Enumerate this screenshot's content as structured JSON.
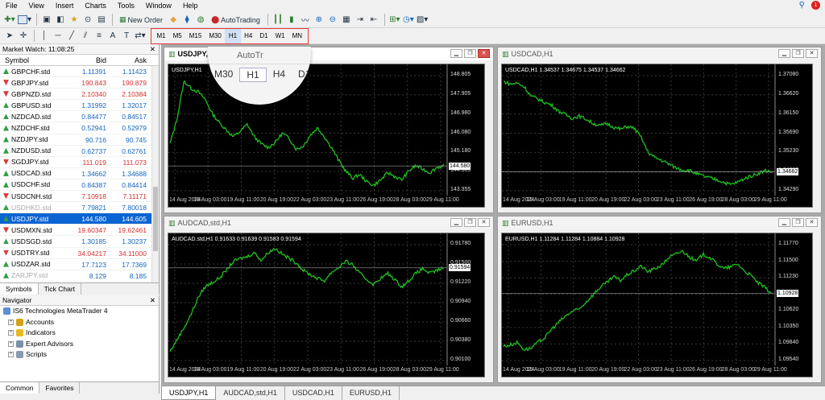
{
  "menu": [
    "File",
    "View",
    "Insert",
    "Charts",
    "Tools",
    "Window",
    "Help"
  ],
  "toolbar": {
    "new_order": "New Order",
    "autotrading": "AutoTrading"
  },
  "timeframes": [
    "M1",
    "M5",
    "M15",
    "M30",
    "H1",
    "H4",
    "D1",
    "W1",
    "MN"
  ],
  "selected_timeframe": "H1",
  "magnifier": {
    "items": [
      "M30",
      "H1",
      "H4",
      "D1"
    ],
    "partial_text": "AutoTr"
  },
  "market_watch": {
    "title": "Market Watch: 11:08:25",
    "headers": {
      "symbol": "Symbol",
      "bid": "Bid",
      "ask": "Ask"
    },
    "rows": [
      {
        "symbol": "GBPCHF.std",
        "bid": "1.11391",
        "ask": "1.11423",
        "dir": "up"
      },
      {
        "symbol": "GBPJPY.std",
        "bid": "190.843",
        "ask": "190.879",
        "dir": "dn"
      },
      {
        "symbol": "GBPNZD.std",
        "bid": "2.10340",
        "ask": "2.10384",
        "dir": "dn"
      },
      {
        "symbol": "GBPUSD.std",
        "bid": "1.31992",
        "ask": "1.32017",
        "dir": "up"
      },
      {
        "symbol": "NZDCAD.std",
        "bid": "0.84477",
        "ask": "0.84517",
        "dir": "up"
      },
      {
        "symbol": "NZDCHF.std",
        "bid": "0.52941",
        "ask": "0.52979",
        "dir": "up"
      },
      {
        "symbol": "NZDJPY.std",
        "bid": "90.716",
        "ask": "90.745",
        "dir": "up"
      },
      {
        "symbol": "NZDUSD.std",
        "bid": "0.62737",
        "ask": "0.62761",
        "dir": "up"
      },
      {
        "symbol": "SGDJPY.std",
        "bid": "111.019",
        "ask": "111.073",
        "dir": "dn"
      },
      {
        "symbol": "USDCAD.std",
        "bid": "1.34662",
        "ask": "1.34688",
        "dir": "up"
      },
      {
        "symbol": "USDCHF.std",
        "bid": "0.84387",
        "ask": "0.84414",
        "dir": "up"
      },
      {
        "symbol": "USDCNH.std",
        "bid": "7.10918",
        "ask": "7.11171",
        "dir": "dn"
      },
      {
        "symbol": "USDHKD.std",
        "bid": "7.79821",
        "ask": "7.80018",
        "dir": "up",
        "faded": true
      },
      {
        "symbol": "USDJPY.std",
        "bid": "144.580",
        "ask": "144.605",
        "dir": "up",
        "selected": true
      },
      {
        "symbol": "USDMXN.std",
        "bid": "19.60347",
        "ask": "19.62461",
        "dir": "dn"
      },
      {
        "symbol": "USDSGD.std",
        "bid": "1.30185",
        "ask": "1.30237",
        "dir": "up"
      },
      {
        "symbol": "USDTRY.std",
        "bid": "34.04217",
        "ask": "34.11000",
        "dir": "dn"
      },
      {
        "symbol": "USDZAR.std",
        "bid": "17.7123",
        "ask": "17.7369",
        "dir": "up"
      },
      {
        "symbol": "ZARJPY.std",
        "bid": "8.129",
        "ask": "8.185",
        "dir": "up",
        "faded": true
      }
    ],
    "tabs": [
      "Symbols",
      "Tick Chart"
    ]
  },
  "navigator": {
    "title": "Navigator",
    "root": "IS6 Technologies MetaTrader 4",
    "items": [
      "Accounts",
      "Indicators",
      "Expert Advisors",
      "Scripts"
    ],
    "tabs": [
      "Common",
      "Favorites"
    ]
  },
  "charts": [
    {
      "title": "USDJPY,H1",
      "info": "USDJPY,H1",
      "price_label": "144.580",
      "yticks": [
        "148.805",
        "147.905",
        "146.980",
        "146.080",
        "145.180",
        "144.305",
        "143.355"
      ],
      "xticks": [
        "14 Aug 2024",
        "16 Aug 03:00",
        "19 Aug 11:00",
        "20 Aug 19:00",
        "22 Aug 03:00",
        "23 Aug 11:00",
        "26 Aug 19:00",
        "28 Aug 03:00",
        "29 Aug 11:00"
      ],
      "values": [
        145.8,
        147.2,
        149.3,
        148.9,
        148.7,
        148.3,
        147.5,
        147.0,
        146.6,
        146.2,
        146.5,
        146.9,
        146.2,
        145.8,
        145.6,
        145.9,
        146.4,
        146.1,
        145.5,
        145.7,
        146.3,
        146.7,
        146.2,
        145.6,
        144.9,
        144.3,
        143.9,
        144.1,
        143.7,
        143.5,
        143.8,
        144.2,
        144.0,
        143.8,
        144.3,
        144.6,
        144.4,
        144.2,
        144.5,
        144.58
      ],
      "ymin": 143.2,
      "ymax": 149.6
    },
    {
      "title": "USDCAD,H1",
      "info": "USDCAD,H1  1.34537 1.34675 1.34537 1.34662",
      "price_label": "1.34662",
      "yticks": [
        "1.37080",
        "1.36620",
        "1.36150",
        "1.35690",
        "1.35230",
        "1.34662",
        "1.34290"
      ],
      "xticks": [
        "14 Aug 2024",
        "16 Aug 03:00",
        "19 Aug 11:00",
        "20 Aug 19:00",
        "22 Aug 03:00",
        "23 Aug 11:00",
        "26 Aug 19:00",
        "28 Aug 03:00",
        "29 Aug 11:00"
      ],
      "values": [
        1.3712,
        1.3705,
        1.3708,
        1.3698,
        1.3672,
        1.3665,
        1.3655,
        1.3648,
        1.3632,
        1.3622,
        1.3612,
        1.3618,
        1.361,
        1.3598,
        1.3592,
        1.3598,
        1.3588,
        1.3582,
        1.359,
        1.3585,
        1.356,
        1.352,
        1.3505,
        1.3498,
        1.3488,
        1.3478,
        1.3472,
        1.347,
        1.3462,
        1.3455,
        1.345,
        1.3445,
        1.3438,
        1.3432,
        1.3438,
        1.3448,
        1.3455,
        1.3462,
        1.347,
        1.34662
      ],
      "ymin": 1.3415,
      "ymax": 1.3728
    },
    {
      "title": "AUDCAD,std,H1",
      "info": "AUDCAD.std,H1  0.91633 0.91639 0.91583 0.91594",
      "price_label": "0.91594",
      "yticks": [
        "0.91780",
        "0.91500",
        "0.91220",
        "0.90940",
        "0.90660",
        "0.90380",
        "0.90100"
      ],
      "xticks": [
        "14 Aug 2024",
        "16 Aug 03:00",
        "19 Aug 11:00",
        "20 Aug 19:00",
        "22 Aug 03:00",
        "23 Aug 11:00",
        "26 Aug 19:00",
        "28 Aug 03:00",
        "29 Aug 11:00"
      ],
      "values": [
        0.902,
        0.904,
        0.906,
        0.9082,
        0.911,
        0.9128,
        0.9135,
        0.9142,
        0.9155,
        0.917,
        0.9175,
        0.9178,
        0.9185,
        0.9172,
        0.9185,
        0.9192,
        0.9182,
        0.9175,
        0.9168,
        0.9155,
        0.9148,
        0.9142,
        0.9138,
        0.9152,
        0.916,
        0.917,
        0.9165,
        0.915,
        0.914,
        0.9132,
        0.9142,
        0.915,
        0.914,
        0.9128,
        0.9138,
        0.915,
        0.9158,
        0.915,
        0.9155,
        0.91594
      ],
      "ymin": 0.9005,
      "ymax": 0.9198
    },
    {
      "title": "EURUSD,H1",
      "info": "EURUSD,H1  1.11284 1.11284 1.10884 1.10928",
      "price_label": "1.10928",
      "yticks": [
        "1.11770",
        "1.11500",
        "1.11230",
        "1.10928",
        "1.10620",
        "1.10350",
        "1.09840",
        "1.09540"
      ],
      "xticks": [
        "14 Aug 2024",
        "16 Aug 03:00",
        "19 Aug 11:00",
        "20 Aug 19:00",
        "22 Aug 03:00",
        "23 Aug 11:00",
        "26 Aug 19:00",
        "28 Aug 03:00",
        "29 Aug 11:00"
      ],
      "values": [
        1.0982,
        1.0985,
        1.099,
        1.0975,
        1.0978,
        1.099,
        1.1,
        1.1018,
        1.1032,
        1.1045,
        1.1055,
        1.106,
        1.1075,
        1.109,
        1.1105,
        1.1115,
        1.1128,
        1.112,
        1.1132,
        1.114,
        1.115,
        1.1138,
        1.1145,
        1.1152,
        1.1168,
        1.1175,
        1.1182,
        1.117,
        1.116,
        1.1175,
        1.1168,
        1.1155,
        1.1145,
        1.1148,
        1.1155,
        1.114,
        1.113,
        1.1115,
        1.1105,
        1.10928
      ],
      "ymin": 1.0952,
      "ymax": 1.1195
    }
  ],
  "bottom_tabs": [
    "USDJPY,H1",
    "AUDCAD,std,H1",
    "USDCAD,H1",
    "EURUSD,H1"
  ]
}
